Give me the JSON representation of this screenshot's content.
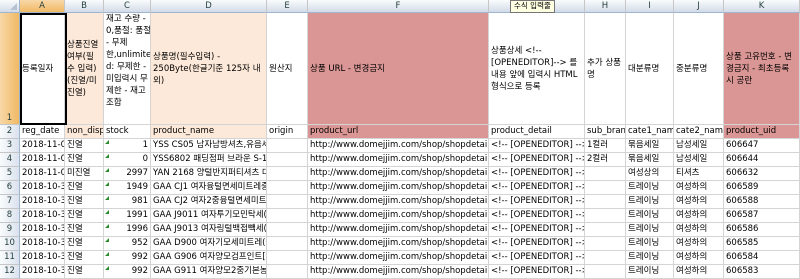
{
  "tooltip": "수식 입력줄",
  "columns": [
    {
      "letter": "A",
      "w": 45
    },
    {
      "letter": "B",
      "w": 39
    },
    {
      "letter": "C",
      "w": 47
    },
    {
      "letter": "D",
      "w": 116
    },
    {
      "letter": "E",
      "w": 41
    },
    {
      "letter": "F",
      "w": 181
    },
    {
      "letter": "G",
      "w": 96
    },
    {
      "letter": "H",
      "w": 41
    },
    {
      "letter": "I",
      "w": 48
    },
    {
      "letter": "J",
      "w": 50
    },
    {
      "letter": "K",
      "w": 76
    }
  ],
  "row_numbers": [
    "1",
    "2",
    "3",
    "4",
    "5",
    "6",
    "7",
    "8",
    "9",
    "10",
    "11",
    "12"
  ],
  "header_row": [
    {
      "text": "등록일자",
      "fill": "",
      "valign": "mid"
    },
    {
      "text": "상품진열 여부(필수 입력) (진열/미 진열)",
      "fill": "peach",
      "valign": "mid"
    },
    {
      "text": "재고 수량 - 0,품절: 품절 - 무제 한,unlimite d: 무제한 - 미입력시 무제한 - 재고 조합",
      "fill": "",
      "valign": "top"
    },
    {
      "text": "상품명(필수입력) - 250Byte(한글기준 125자 내외)",
      "fill": "peach",
      "valign": "mid"
    },
    {
      "text": "원산지",
      "fill": "",
      "valign": "mid"
    },
    {
      "text": "상품 URL - 변경금지",
      "fill": "rose",
      "valign": "mid"
    },
    {
      "text": "상품상세 <!--[OPENEDITOR]--> 를 내용 앞에 입력시 HTML 형식으로 등록",
      "fill": "",
      "valign": "mid"
    },
    {
      "text": "추가 상품명",
      "fill": "",
      "valign": "mid"
    },
    {
      "text": "대분류명",
      "fill": "",
      "valign": "mid"
    },
    {
      "text": "중분류명",
      "fill": "",
      "valign": "mid"
    },
    {
      "text": "상품 고유번호 - 변경금지 - 최초등록시 공란",
      "fill": "rose",
      "valign": "mid"
    }
  ],
  "field_row": [
    "reg_date",
    "non_displ",
    "stock",
    "product_name",
    "origin",
    "product_url",
    "product_detail",
    "sub_brand_n",
    "cate1_nam",
    "cate2_name",
    "product_uid"
  ],
  "data_rows": [
    [
      "2018-11-02",
      "진열",
      "1",
      "YSS CS05 남자남방셔츠,유음세중국OEM",
      "",
      "http://www.domejjim.com/shop/shopdetail.ht",
      "<!-- [OPENEDITOR] -->",
      "1컬러",
      "묶음세일",
      "남성세일",
      "606647"
    ],
    [
      "2018-11-02",
      "진열",
      "0",
      "YSS6802 패딩점퍼  브라운 S-1중국",
      "",
      "http://www.domejjim.com/shop/shopdetail.ht",
      "<!-- [OPENEDITOR] -->",
      "2컬러",
      "묶음세일",
      "남성세일",
      "606644"
    ],
    [
      "2018-11-02",
      "미진열",
      "2997",
      "YAN 2168 양털반지퍼티셔츠   대한민국",
      "",
      "http://www.domejjim.com/shop/shopdetail.ht",
      "<!-- [OPENEDITOR] -->",
      "",
      "여성상의",
      "티셔츠",
      "606632"
    ],
    [
      "2018-10-31",
      "진열",
      "1949",
      "GAA CJ1 여자융털면세미트레중국",
      "",
      "http://www.domejjim.com/shop/shopdetail.ht",
      "<!-- [OPENEDITOR] -->",
      "",
      "트레이닝",
      "여성하의",
      "606589"
    ],
    [
      "2018-10-31",
      "진열",
      "981",
      "GAA CJ2 여자2중융털면세미트중국",
      "",
      "http://www.domejjim.com/shop/shopdetail.ht",
      "<!-- [OPENEDITOR] -->",
      "",
      "트레이닝",
      "여성하의",
      "606588"
    ],
    [
      "2018-10-31",
      "진열",
      "1991",
      "GAA J9011 여자투기모민탁세(중국",
      "",
      "http://www.domejjim.com/shop/shopdetail.ht",
      "<!-- [OPENEDITOR] -->",
      "",
      "트레이닝",
      "여성하의",
      "606587"
    ],
    [
      "2018-10-31",
      "진열",
      "1996",
      "GAA J9013 여자링털백접빽세(중국",
      "",
      "http://www.domejjim.com/shop/shopdetail.ht",
      "<!-- [OPENEDITOR] -->",
      "",
      "트레이닝",
      "여성하의",
      "606586"
    ],
    [
      "2018-10-31",
      "진열",
      "952",
      "GAA D900 여자기모세미트레(중국",
      "",
      "http://www.domejjim.com/shop/shopdetail.ht",
      "<!-- [OPENEDITOR] -->",
      "",
      "트레이닝",
      "여성하의",
      "606585"
    ],
    [
      "2018-10-31",
      "진열",
      "992",
      "GAA G906 여자양모검프인트[중국",
      "",
      "http://www.domejjim.com/shop/shopdetail.ht",
      "<!-- [OPENEDITOR] -->",
      "",
      "트레이닝",
      "여성하의",
      "606584"
    ],
    [
      "2018-10-31",
      "진열",
      "992",
      "GAA G911 여자양모2중기본농중국",
      "",
      "http://www.domejjim.com/shop/shopdetail.ht",
      "<!-- [OPENEDITOR] -->",
      "",
      "트레이닝",
      "여성하의",
      "606583"
    ]
  ]
}
